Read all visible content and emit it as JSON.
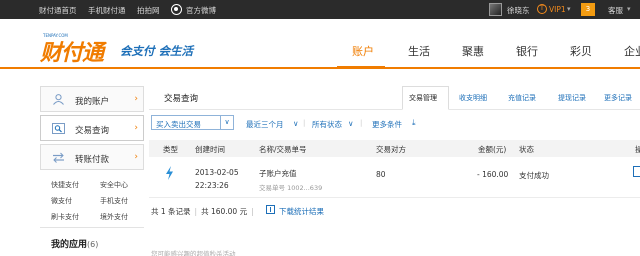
{
  "topbar": {
    "links": [
      "财付通首页",
      "手机财付通",
      "拍拍网",
      "官方微博"
    ],
    "username": "徐晓东",
    "vip_label": "VIP1",
    "message_count": "3",
    "service_label": "客服"
  },
  "header": {
    "logo_small": "TENPAY.COM",
    "logo_text": "财付通",
    "slogan": "会支付 会生活",
    "nav": [
      "账户",
      "生活",
      "聚惠",
      "银行",
      "彩贝",
      "企业"
    ],
    "active_nav": "账户",
    "accent_color": "#f07c00",
    "link_color": "#1d6fb8"
  },
  "sidebar": {
    "items": [
      {
        "label": "我的账户",
        "icon": "user-icon"
      },
      {
        "label": "交易查询",
        "icon": "magnifier-icon"
      },
      {
        "label": "转账付款",
        "icon": "transfer-icon"
      }
    ],
    "active_item": "交易查询",
    "quick_links": [
      "快捷支付",
      "安全中心",
      "微支付",
      "手机支付",
      "刷卡支付",
      "境外支付"
    ],
    "my_apps_label": "我的应用",
    "my_apps_count": "(6)"
  },
  "main": {
    "title": "交易查询",
    "tabs": [
      "交易管理",
      "收支明细",
      "充值记录",
      "提现记录",
      "更多记录"
    ],
    "active_tab": "交易管理",
    "filters": {
      "type_select": "买入卖出交易",
      "period": "最近三个月",
      "status": "所有状态",
      "more": "更多条件"
    },
    "table": {
      "columns": [
        "类型",
        "创建时间",
        "名称/交易单号",
        "交易对方",
        "金额(元)",
        "状态",
        "操作"
      ],
      "rows": [
        {
          "type_icon": "lightning-icon",
          "date": "2013-02-05",
          "time": "22:23:26",
          "name": "子账户充值",
          "order_no": "交易单号 1002...639",
          "counterparty": "80",
          "amount": "- 160.00",
          "status": "支付成功"
        }
      ]
    },
    "summary": {
      "count_text": "共 1 条记录",
      "total_text": "共 160.00 元",
      "download_label": "下载统计结果"
    },
    "bottom_note": "您可能感兴趣的超值秒杀活动"
  }
}
